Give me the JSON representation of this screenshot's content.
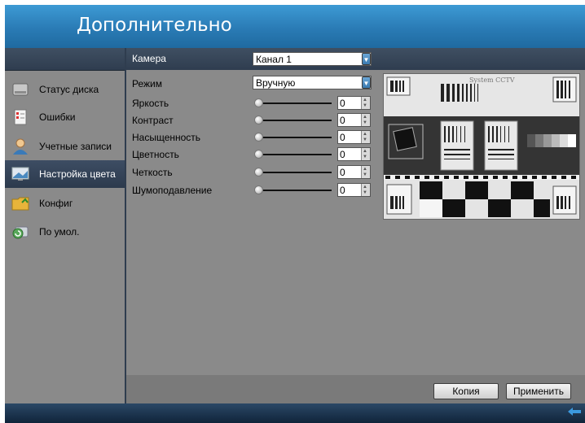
{
  "window": {
    "title": "Дополнительно"
  },
  "sidebar": {
    "items": [
      {
        "label": "Статус диска",
        "icon": "disk-icon",
        "active": false
      },
      {
        "label": "Ошибки",
        "icon": "error-log-icon",
        "active": false
      },
      {
        "label": "Учетные записи",
        "icon": "user-icon",
        "active": false
      },
      {
        "label": "Настройка цвета",
        "icon": "monitor-icon",
        "active": true
      },
      {
        "label": "Конфиг",
        "icon": "folder-icon",
        "active": false
      },
      {
        "label": "По умол.",
        "icon": "reset-icon",
        "active": false
      }
    ]
  },
  "main": {
    "camera_label": "Камера",
    "camera_value": "Канал 1",
    "mode_label": "Режим",
    "mode_value": "Вручную",
    "settings": [
      {
        "label": "Яркость",
        "value": "0",
        "level": 0
      },
      {
        "label": "Контраст",
        "value": "0",
        "level": 0
      },
      {
        "label": "Насыщенность",
        "value": "0",
        "level": 0
      },
      {
        "label": "Цветность",
        "value": "0",
        "level": 0
      },
      {
        "label": "Четкость",
        "value": "0",
        "level": 0
      },
      {
        "label": "Шумоподавление",
        "value": "0",
        "level": 0
      }
    ],
    "preview_text": "System CCTV"
  },
  "footer": {
    "copy_label": "Копия",
    "apply_label": "Применить"
  },
  "colors": {
    "accent": "#2a7bb5",
    "panel": "#8a8a8a",
    "active": "#2f3d4f"
  }
}
